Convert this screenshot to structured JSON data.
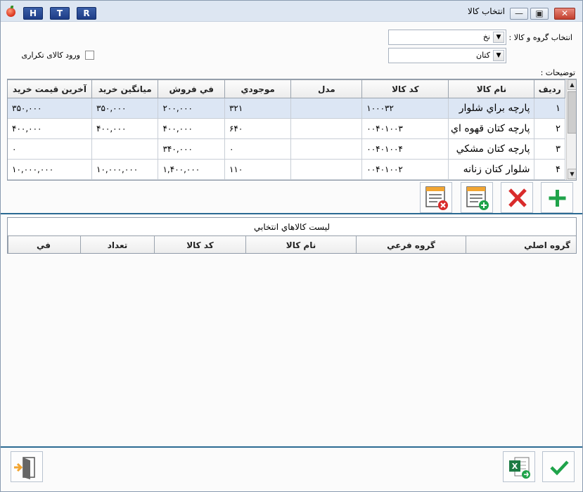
{
  "window": {
    "title": "انتخاب کالا",
    "title_buttons": [
      "H",
      "T",
      "R"
    ],
    "minimize_glyph": "—",
    "maximize_glyph": "▣",
    "close_glyph": "✕"
  },
  "filters": {
    "group_label": "انتخاب گروه و کالا :",
    "group_value": "نخ",
    "item_value": "کتان",
    "repeat_label": "ورود کالای تکراری",
    "repeat_checked": false,
    "notes_label": "توضیحات :"
  },
  "goods_table": {
    "columns": [
      "رديف",
      "نام کالا",
      "کد کالا",
      "مدل",
      "موجودي",
      "في فروش",
      "ميانگين خريد",
      "آخرين قيمت خريد"
    ],
    "rows": [
      {
        "idx": "۱",
        "name": "پارچه براي شلوار",
        "code": "۱۰۰۰۳۲",
        "model": "",
        "stock": "۳۲۱",
        "sale": "۲۰۰,۰۰۰",
        "avg": "۳۵۰,۰۰۰",
        "last": "۳۵۰,۰۰۰"
      },
      {
        "idx": "۲",
        "name": "پارچه کتان قهوه اي",
        "code": "۰۰۴۰۱۰۰۳",
        "model": "",
        "stock": "۶۴۰",
        "sale": "۴۰۰,۰۰۰",
        "avg": "۴۰۰,۰۰۰",
        "last": "۴۰۰,۰۰۰"
      },
      {
        "idx": "۳",
        "name": "پارچه کتان مشکي",
        "code": "۰۰۴۰۱۰۰۴",
        "model": "",
        "stock": "۰",
        "sale": "۳۴۰,۰۰۰",
        "avg": "",
        "last": "۰"
      },
      {
        "idx": "۴",
        "name": "شلوار کتان زنانه",
        "code": "۰۰۴۰۱۰۰۲",
        "model": "",
        "stock": "۱۱۰",
        "sale": "۱,۴۰۰,۰۰۰",
        "avg": "۱۰,۰۰۰,۰۰۰",
        "last": "۱۰,۰۰۰,۰۰۰"
      }
    ],
    "selected_row": 0
  },
  "actions": {
    "add_icon": "plus-icon",
    "delete_icon": "x-icon",
    "add_all_icon": "list-add-icon",
    "remove_all_icon": "list-remove-icon"
  },
  "selected_list": {
    "title": "ليست کالاهاي انتخابي",
    "columns": [
      "گروه اصلي",
      "گروه فرعي",
      "نام کالا",
      "کد کالا",
      "تعداد",
      "في"
    ]
  },
  "colors": {
    "accent_blue": "#2b6a93",
    "green": "#1fa34a",
    "red": "#d92b2b",
    "orange": "#f2a531",
    "excel_green": "#1d7a44"
  }
}
